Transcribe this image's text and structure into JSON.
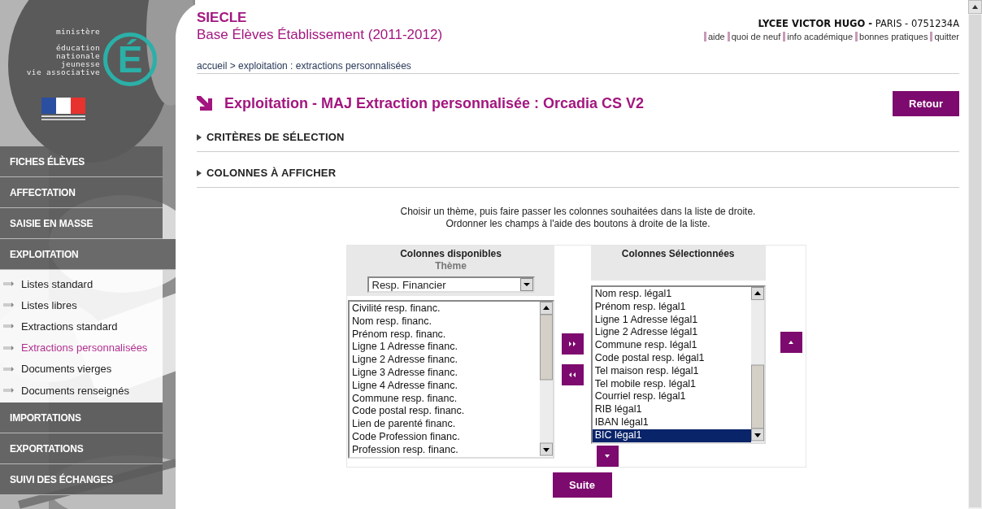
{
  "logo": {
    "caption": "ministère",
    "lines": [
      "éducation",
      "nationale",
      "jeunesse",
      "vie associative"
    ],
    "letter": "É"
  },
  "menu": [
    {
      "label": "FICHES ÉLÈVES"
    },
    {
      "label": "AFFECTATION"
    },
    {
      "label": "SAISIE EN MASSE"
    },
    {
      "label": "EXPLOITATION",
      "children": [
        {
          "label": "Listes standard",
          "selected": false
        },
        {
          "label": "Listes libres",
          "selected": false
        },
        {
          "label": "Extractions standard",
          "selected": false
        },
        {
          "label": "Extractions personnalisées",
          "selected": true
        },
        {
          "label": "Documents vierges",
          "selected": false
        },
        {
          "label": "Documents renseignés",
          "selected": false
        }
      ]
    },
    {
      "label": "IMPORTATIONS"
    },
    {
      "label": "EXPORTATIONS"
    },
    {
      "label": "SUIVI DES ÉCHANGES"
    }
  ],
  "header": {
    "app": "SIECLE",
    "subtitle": "Base Élèves Établissement (2011-2012)",
    "school": "**LYCEE VICTOR HUGO -** PARIS - 0751234A",
    "links": [
      "aide",
      "quoi de neuf",
      "info académique",
      "bonnes pratiques",
      "quitter"
    ]
  },
  "breadcrumb": "accueil > exploitation : extractions personnalisées",
  "page_title": "Exploitation - MAJ Extraction personnalisée : Orcadia CS V2",
  "back_button": "Retour",
  "sections": [
    {
      "label": "CRITÈRES DE SÉLECTION"
    },
    {
      "label": "COLONNES À AFFICHER"
    }
  ],
  "instructions": [
    "Choisir un thème, puis faire passer les colonnes souhaitées dans la liste de droite.",
    "Ordonner les champs à l'aide des boutons à droite de la liste."
  ],
  "available": {
    "title": "Colonnes disponibles",
    "theme_label": "Thème",
    "theme_value": "Resp. Financier",
    "items": [
      {
        "label": "Civilité resp. financ.",
        "selected": false
      },
      {
        "label": "Nom resp. financ.",
        "selected": false
      },
      {
        "label": "Prénom resp. financ.",
        "selected": false
      },
      {
        "label": "Ligne 1 Adresse financ.",
        "selected": false
      },
      {
        "label": "Ligne 2 Adresse financ.",
        "selected": false
      },
      {
        "label": "Ligne 3 Adresse financ.",
        "selected": false
      },
      {
        "label": "Ligne 4 Adresse financ.",
        "selected": false
      },
      {
        "label": "Commune resp. financ.",
        "selected": false
      },
      {
        "label": "Code postal resp. financ.",
        "selected": false
      },
      {
        "label": "Lien de parenté financ.",
        "selected": false
      },
      {
        "label": "Code Profession financ.",
        "selected": false
      },
      {
        "label": "Profession resp. financ.",
        "selected": false
      }
    ]
  },
  "chosen": {
    "title": "Colonnes Sélectionnées",
    "items": [
      {
        "label": "Nom resp. légal1",
        "selected": false
      },
      {
        "label": "Prénom resp. légal1",
        "selected": false
      },
      {
        "label": "Ligne 1 Adresse légal1",
        "selected": false
      },
      {
        "label": "Ligne 2 Adresse légal1",
        "selected": false
      },
      {
        "label": "Commune resp. légal1",
        "selected": false
      },
      {
        "label": "Code postal resp. légal1",
        "selected": false
      },
      {
        "label": "Tel maison resp. légal1",
        "selected": false
      },
      {
        "label": "Tel mobile resp. légal1",
        "selected": false
      },
      {
        "label": "Courriel resp. légal1",
        "selected": false
      },
      {
        "label": "RIB légal1",
        "selected": false
      },
      {
        "label": "IBAN légal1",
        "selected": false
      },
      {
        "label": "BIC légal1",
        "selected": true
      }
    ]
  },
  "submit": "Suite"
}
